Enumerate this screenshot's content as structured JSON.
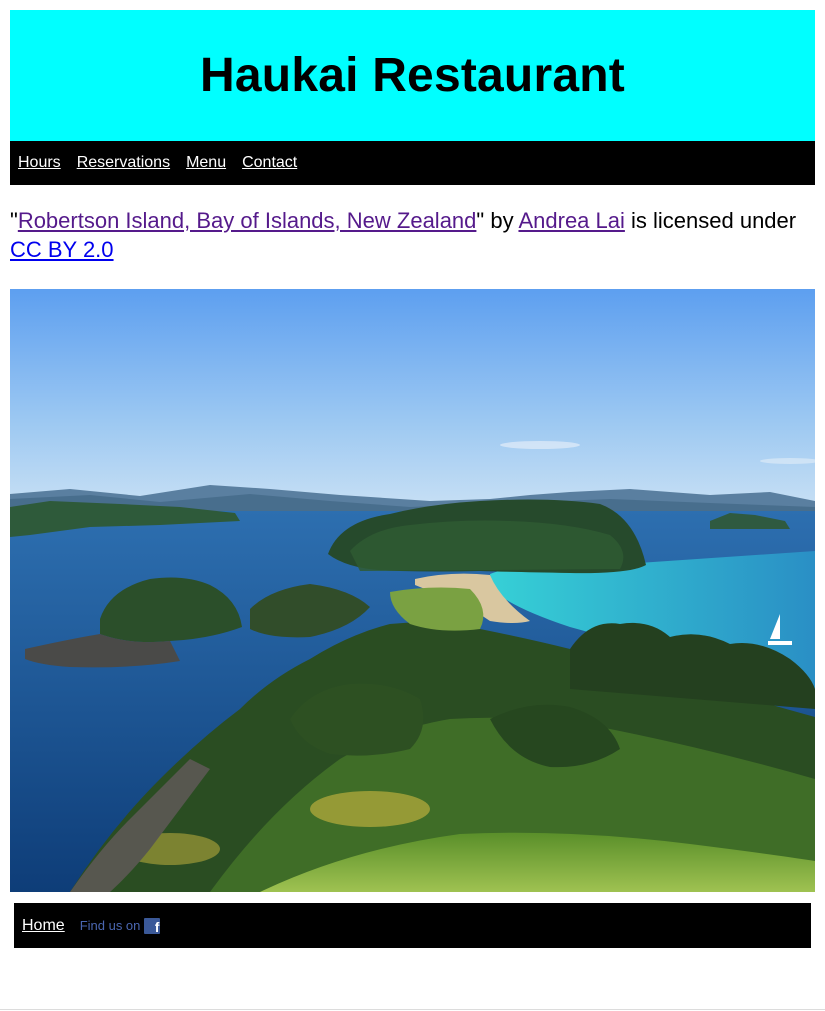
{
  "header": {
    "title": "Haukai Restaurant"
  },
  "nav": {
    "items": [
      {
        "label": "Hours"
      },
      {
        "label": "Reservations"
      },
      {
        "label": "Menu"
      },
      {
        "label": "Contact"
      }
    ]
  },
  "attribution": {
    "quote_open": "\"",
    "photo_title": "Robertson Island, Bay of Islands, New Zealand",
    "by_text": "\" by ",
    "author": "Andrea Lai",
    "licensed_text": " is licensed under ",
    "license": "CC BY 2.0"
  },
  "photo": {
    "alt": "Robertson Island, Bay of Islands, New Zealand"
  },
  "footer": {
    "home_label": "Home",
    "find_us_label": "Find us on",
    "facebook_glyph": "f",
    "facebook_color": "#3b5998"
  },
  "colors": {
    "header_bg": "#00ffff",
    "nav_bg": "#000000",
    "visited_link": "#551a8b",
    "link": "#0000ee"
  }
}
